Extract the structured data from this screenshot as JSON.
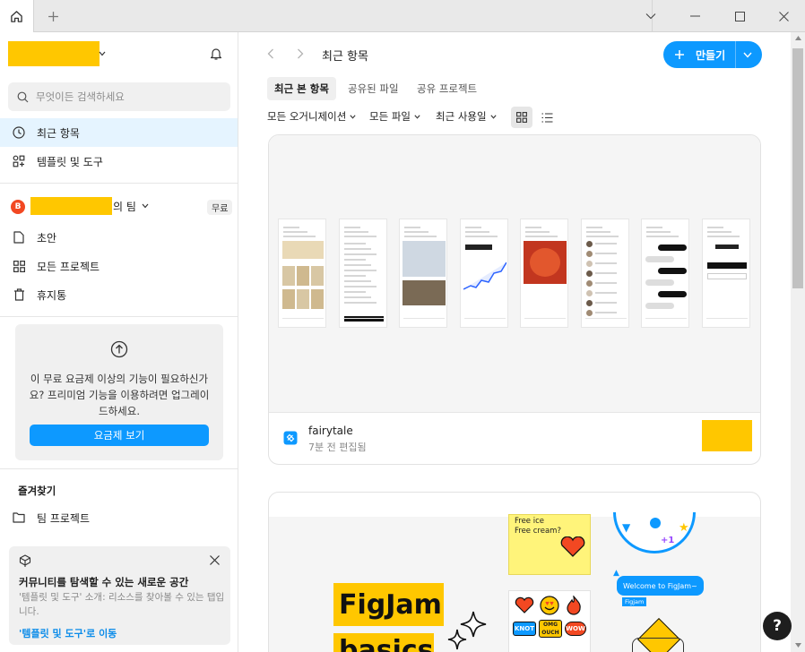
{
  "topbar": {
    "home_icon": "home-icon",
    "new_tab_icon": "plus-icon",
    "window_controls": [
      "chevron-down-icon",
      "minimize-icon",
      "maximize-icon",
      "close-icon"
    ]
  },
  "sidebar": {
    "notification_icon": "bell-icon",
    "search_placeholder": "무엇이든 검색하세요",
    "nav": [
      {
        "label": "최근 항목",
        "icon": "clock-icon",
        "active": true
      },
      {
        "label": "템플릿 및 도구",
        "icon": "shapes-icon",
        "active": false
      }
    ],
    "team": {
      "avatar_letter": "B",
      "suffix": "의 팀",
      "badge": "무료",
      "items": [
        {
          "label": "초안",
          "icon": "file-icon"
        },
        {
          "label": "모든 프로젝트",
          "icon": "grid-icon"
        },
        {
          "label": "휴지통",
          "icon": "trash-icon"
        }
      ]
    },
    "upsell": {
      "text": "이 무료 요금제 이상의 기능이 필요하신가요? 프리미엄 기능을 이용하려면 업그레이드하세요.",
      "button": "요금제 보기"
    },
    "favorites": {
      "heading": "즐겨찾기",
      "items": [
        {
          "label": "팀 프로젝트",
          "icon": "folder-icon"
        }
      ]
    },
    "banner": {
      "title": "커뮤니티를 탐색할 수 있는 새로운 공간",
      "body": "'템플릿 및 도구' 소개: 리소스를 찾아볼 수 있는 탭입니다.",
      "link": "'템플릿 및 도구'로 이동"
    }
  },
  "main": {
    "title": "최근 항목",
    "create_label": "만들기",
    "tabs": [
      {
        "label": "최근 본 항목",
        "active": true
      },
      {
        "label": "공유된 파일",
        "active": false
      },
      {
        "label": "공유 프로젝트",
        "active": false
      }
    ],
    "filters": [
      "모든 오거니제이션",
      "모든 파일",
      "최근 사용일"
    ],
    "files": [
      {
        "name": "fairytale",
        "edited": "7분 전 편집됨",
        "type_icon": "figma-design-file-icon"
      }
    ],
    "figjam": {
      "title_1": "FigJam",
      "title_2": "basics",
      "note_items": [
        "Free ice",
        "Free cream?"
      ],
      "chat_bubble": "Welcome to FigJam~",
      "chat_label": "Figjam",
      "stickers": [
        "OMG",
        "WOW",
        "OMG OUCH",
        "KNOT"
      ]
    },
    "help_label": "?"
  },
  "colors": {
    "accent": "#0d99ff",
    "redaction": "#ffc700",
    "active_nav": "#e5f4ff",
    "avatar": "#f24822"
  }
}
